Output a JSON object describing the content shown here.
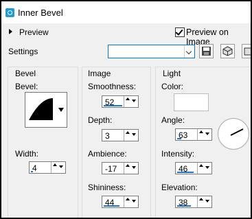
{
  "window": {
    "title": "Inner Bevel",
    "icon": "inner-bevel-icon"
  },
  "preview": {
    "toggle_label": "Preview",
    "on_image_label": "Preview on Image",
    "on_image_checked": true
  },
  "settings": {
    "label": "Settings",
    "preset_value": "",
    "buttons": [
      "save-preset-icon",
      "presets-cube-icon",
      "more-icon"
    ]
  },
  "bevel_group": {
    "title": "Bevel",
    "bevel_label": "Bevel:",
    "width_label": "Width:",
    "width_value": "4"
  },
  "image_group": {
    "title": "Image",
    "smoothness_label": "Smoothness:",
    "smoothness_value": "52",
    "depth_label": "Depth:",
    "depth_value": "3",
    "ambience_label": "Ambience:",
    "ambience_value": "-17",
    "shininess_label": "Shininess:",
    "shininess_value": "44"
  },
  "light_group": {
    "title": "Light",
    "color_label": "Color:",
    "color_value": "#ffffff",
    "angle_label": "Angle:",
    "angle_value": "63",
    "intensity_label": "Intensity:",
    "intensity_value": "46",
    "elevation_label": "Elevation:",
    "elevation_value": "38"
  },
  "colors": {
    "accent": "#1a75d2"
  }
}
